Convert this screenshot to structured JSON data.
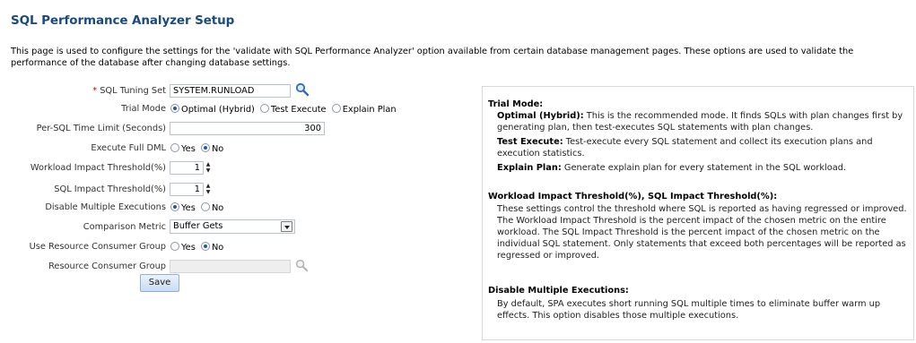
{
  "page": {
    "title": "SQL Performance Analyzer Setup",
    "intro": "This page is used to configure the settings for the 'validate with SQL Performance Analyzer' option available from certain database management pages. These options are used to validate the performance of the database after changing database settings."
  },
  "form": {
    "sql_tuning_set": {
      "required_mark": "*",
      "label": "SQL Tuning Set",
      "value": "SYSTEM.RUNLOAD",
      "icon": "search-icon"
    },
    "trial_mode": {
      "label": "Trial Mode",
      "options": [
        "Optimal (Hybrid)",
        "Test Execute",
        "Explain Plan"
      ],
      "selected": "Optimal (Hybrid)"
    },
    "time_limit": {
      "label": "Per-SQL Time Limit (Seconds)",
      "value": "300"
    },
    "execute_full_dml": {
      "label": "Execute Full DML",
      "options": [
        "Yes",
        "No"
      ],
      "selected": "No"
    },
    "workload_threshold": {
      "label": "Workload Impact Threshold(%)",
      "value": "1"
    },
    "sql_threshold": {
      "label": "SQL Impact Threshold(%)",
      "value": "1"
    },
    "disable_multiple": {
      "label": "Disable Multiple Executions",
      "options": [
        "Yes",
        "No"
      ],
      "selected": "Yes"
    },
    "comparison_metric": {
      "label": "Comparison Metric",
      "value": "Buffer Gets"
    },
    "use_rcg": {
      "label": "Use Resource Consumer Group",
      "options": [
        "Yes",
        "No"
      ],
      "selected": "No"
    },
    "rcg": {
      "label": "Resource Consumer Group",
      "value": "",
      "icon": "search-icon"
    },
    "save_label": "Save"
  },
  "help": {
    "trial_mode": {
      "heading": "Trial Mode:",
      "optimal_term": "Optimal (Hybrid):",
      "optimal_text": "This is the recommended mode. It finds SQLs with plan changes first by generating plan, then test-executes SQL statements with plan changes.",
      "test_term": "Test Execute:",
      "test_text": "Test-execute every SQL statement and collect its execution plans and execution statistics.",
      "explain_term": "Explain Plan:",
      "explain_text": "Generate explain plan for every statement in the SQL workload."
    },
    "threshold": {
      "heading": "Workload Impact Threshold(%), SQL Impact Threshold(%):",
      "text": "These settings control the threshold where SQL is reported as having regressed or improved. The Workload Impact Threshold is the percent impact of the chosen metric on the entire workload. The SQL Impact Threshold is the percent impact of the chosen metric on the individual SQL statement. Only statements that exceed both percentages will be reported as regressed or improved."
    },
    "disable": {
      "heading": "Disable Multiple Executions:",
      "text": "By default, SPA executes short running SQL multiple times to eliminate buffer warm up effects. This option disables those multiple executions."
    }
  }
}
